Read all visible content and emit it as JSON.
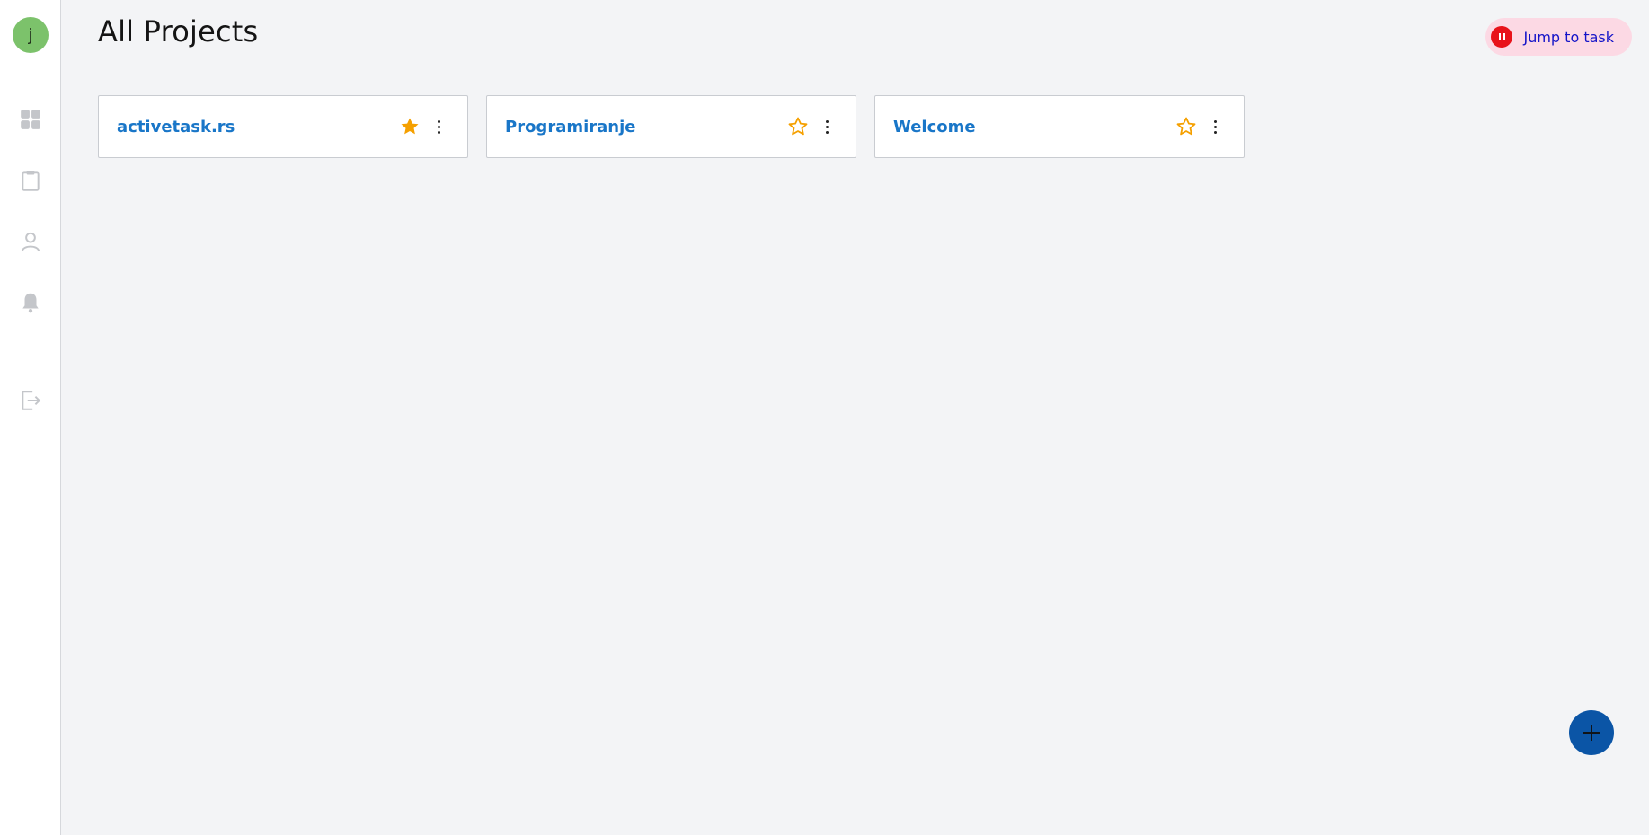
{
  "user": {
    "avatar_initial": "j",
    "avatar_color": "#7cc26b"
  },
  "sidebar": {
    "items": [
      {
        "name": "dashboard",
        "icon": "grid-icon"
      },
      {
        "name": "tasks",
        "icon": "clipboard-icon"
      },
      {
        "name": "profile",
        "icon": "user-icon"
      },
      {
        "name": "notifications",
        "icon": "bell-icon"
      },
      {
        "name": "logout",
        "icon": "logout-icon"
      }
    ]
  },
  "header": {
    "title": "All Projects",
    "jump_button": {
      "label": "Jump to task",
      "icon": "pause-icon"
    }
  },
  "projects": [
    {
      "name": "activetask.rs",
      "favorite": true
    },
    {
      "name": "Programiranje",
      "favorite": false
    },
    {
      "name": "Welcome",
      "favorite": false
    }
  ],
  "fab": {
    "icon": "plus-icon"
  },
  "colors": {
    "accent": "#1976c8",
    "star": "#f5a000",
    "fab": "#0b55a6",
    "jump_bg": "#fcd9e4",
    "pause": "#e8121a"
  }
}
